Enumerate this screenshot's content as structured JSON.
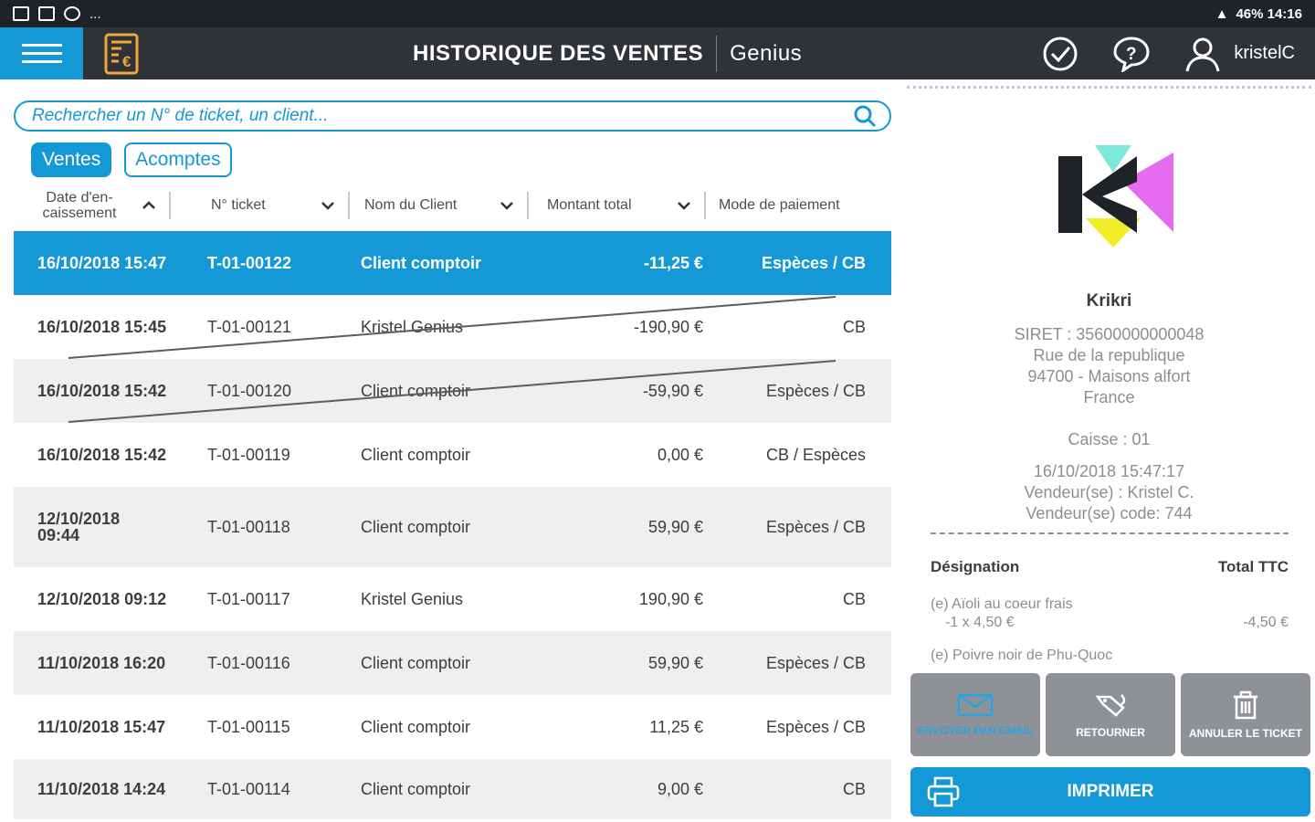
{
  "status_bar": {
    "right_text": "46% 14:16",
    "left_more": "..."
  },
  "header": {
    "title": "HISTORIQUE DES VENTES",
    "brand": "Genius",
    "user": "kristelC"
  },
  "search": {
    "placeholder": "Rechercher un N° de ticket, un client..."
  },
  "tabs": [
    {
      "label": "Ventes",
      "active": true
    },
    {
      "label": "Acomptes",
      "active": false
    }
  ],
  "columns": {
    "date": "Date d'en-caissement",
    "ticket": "N° ticket",
    "client": "Nom du Client",
    "amount": "Montant total",
    "payment": "Mode de paiement"
  },
  "rows": [
    {
      "date": "16/10/2018  15:47",
      "ticket": "T-01-00122",
      "client": "Client comptoir",
      "amount": "-11,25 €",
      "payment": "Espèces / CB",
      "selected": true,
      "struck": false
    },
    {
      "date": "16/10/2018 15:45",
      "ticket": "T-01-00121",
      "client": "Kristel Genius",
      "amount": "-190,90 €",
      "payment": "CB",
      "selected": false,
      "struck": true
    },
    {
      "date": "16/10/2018 15:42",
      "ticket": "T-01-00120",
      "client": "Client comptoir",
      "amount": "-59,90 €",
      "payment": "Espèces / CB",
      "selected": false,
      "struck": true
    },
    {
      "date": "16/10/2018 15:42",
      "ticket": "T-01-00119",
      "client": "Client comptoir",
      "amount": "0,00 €",
      "payment": "CB / Espèces",
      "selected": false,
      "struck": false
    },
    {
      "date": "12/10/2018 09:44",
      "ticket": "T-01-00118",
      "client": "Client comptoir",
      "amount": "59,90 €",
      "payment": "Espèces / CB",
      "selected": false,
      "struck": false
    },
    {
      "date": "12/10/2018 09:12",
      "ticket": "T-01-00117",
      "client": "Kristel Genius",
      "amount": "190,90 €",
      "payment": "CB",
      "selected": false,
      "struck": false
    },
    {
      "date": "11/10/2018 16:20",
      "ticket": "T-01-00116",
      "client": "Client comptoir",
      "amount": "59,90 €",
      "payment": "Espèces / CB",
      "selected": false,
      "struck": false
    },
    {
      "date": "11/10/2018 15:47",
      "ticket": "T-01-00115",
      "client": "Client comptoir",
      "amount": "11,25 €",
      "payment": "Espèces / CB",
      "selected": false,
      "struck": false
    },
    {
      "date": "11/10/2018 14:24",
      "ticket": "T-01-00114",
      "client": "Client comptoir",
      "amount": "9,00 €",
      "payment": "CB",
      "selected": false,
      "struck": false
    }
  ],
  "receipt": {
    "store_name": "Krikri",
    "siret": "SIRET : 35600000000048",
    "street": "Rue de la republique",
    "city": "94700 - Maisons alfort",
    "country": "France",
    "caisse": "Caisse : 01",
    "datetime": "16/10/2018 15:47:17",
    "seller": "Vendeur(se) : Kristel C.",
    "seller_code": "Vendeur(se) code: 744",
    "col_designation": "Désignation",
    "col_total": "Total TTC",
    "items": [
      {
        "name": "(e) Aïoli au coeur frais",
        "qty": "-1 x 4,50 €",
        "total": "-4,50 €"
      },
      {
        "name": "(e) Poivre noir de Phu-Quoc",
        "qty": "",
        "total": ""
      }
    ]
  },
  "actions": {
    "email": "ENVOYER PAR EMAIL",
    "return": "RETOURNER",
    "cancel": "ANNULER LE TICKET",
    "print": "IMPRIMER"
  },
  "colors": {
    "accent": "#1499d6",
    "header_bg": "#2f3236",
    "button_grey": "#8e9196"
  }
}
